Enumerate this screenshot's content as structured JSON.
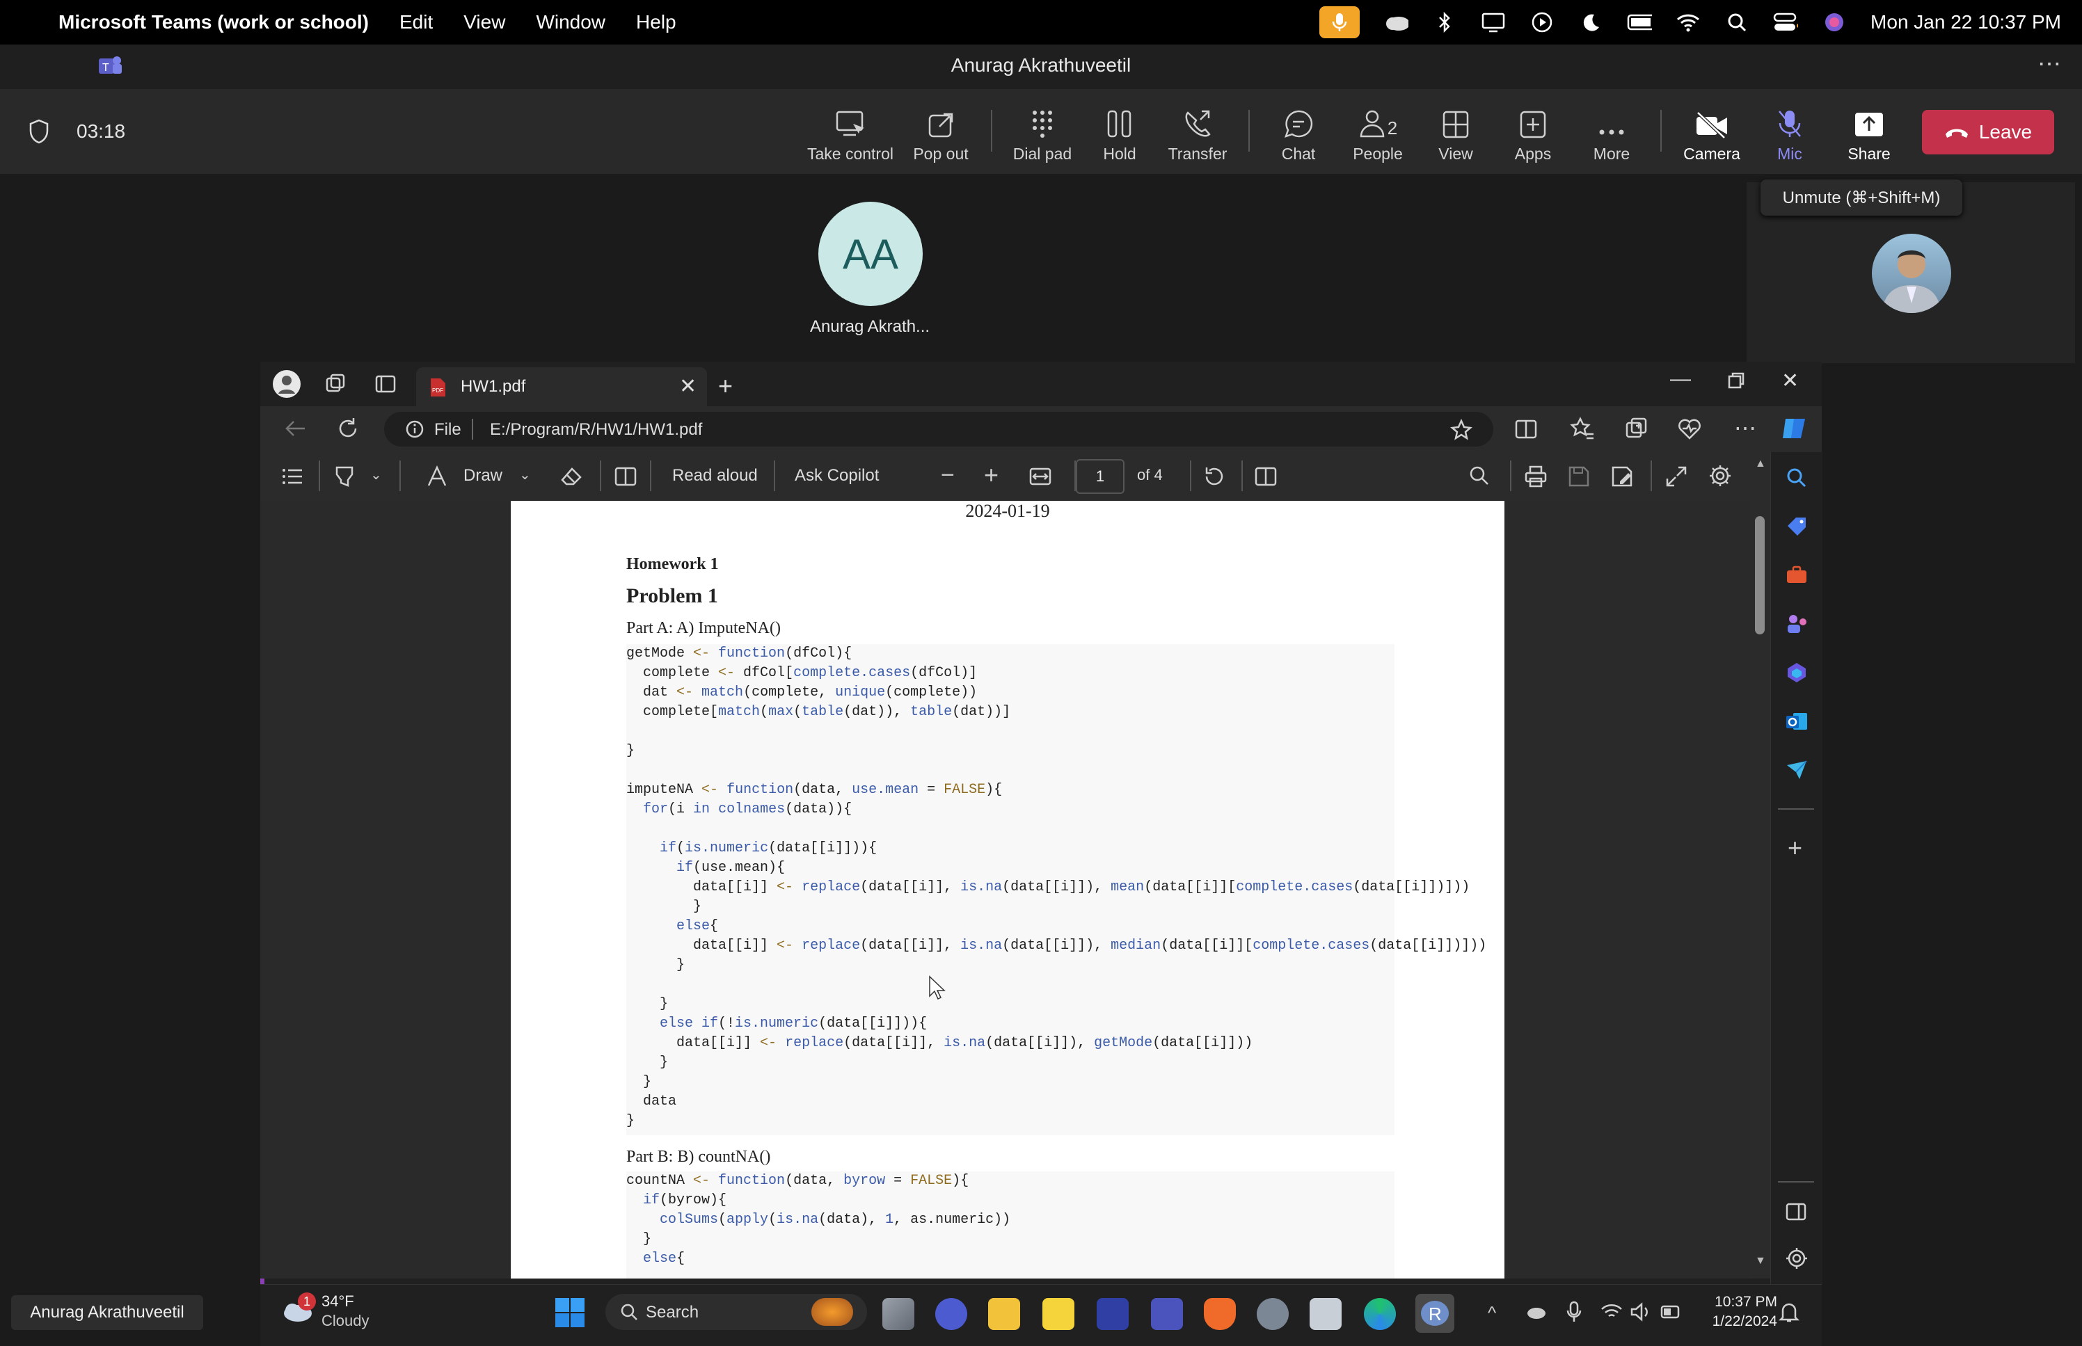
{
  "menubar": {
    "app_name": "Microsoft Teams (work or school)",
    "menus": [
      "Edit",
      "View",
      "Window",
      "Help"
    ],
    "clock": "Mon Jan 22  10:37 PM"
  },
  "teams": {
    "window_title": "Anurag Akrathuveetil",
    "timer": "03:18",
    "toolbar": {
      "take_control": "Take control",
      "pop_out": "Pop out",
      "dial_pad": "Dial pad",
      "hold": "Hold",
      "transfer": "Transfer",
      "chat": "Chat",
      "people": "People",
      "people_count": "2",
      "view": "View",
      "apps": "Apps",
      "more": "More",
      "camera": "Camera",
      "mic": "Mic",
      "share": "Share",
      "leave": "Leave"
    },
    "participant_initials": "AA",
    "participant_name": "Anurag Akrath...",
    "tooltip": "Unmute (⌘+Shift+M)",
    "name_chip": "Anurag Akrathuveetil"
  },
  "browser": {
    "tab_title": "HW1.pdf",
    "file_label": "File",
    "url": "E:/Program/R/HW1/HW1.pdf",
    "pdf_toolbar": {
      "draw": "Draw",
      "read_aloud": "Read aloud",
      "ask_copilot": "Ask Copilot",
      "page_number": "1",
      "page_total": "of 4"
    }
  },
  "pdf": {
    "date": "2024-01-19",
    "heading_small": "Homework 1",
    "heading_problem": "Problem 1",
    "part_a": "Part A: A) ImputeNA()",
    "part_b": "Part B: B) countNA()"
  },
  "taskbar": {
    "weather_temp": "34°F",
    "weather_desc": "Cloudy",
    "weather_badge": "1",
    "search": "Search",
    "time": "10:37 PM",
    "date": "1/22/2024"
  },
  "colors": {
    "leave_red": "#c4314b",
    "mic_active": "#f3a528",
    "avatar_bg": "#c9e8e6",
    "mic_label_purple": "#8c8cf5"
  }
}
